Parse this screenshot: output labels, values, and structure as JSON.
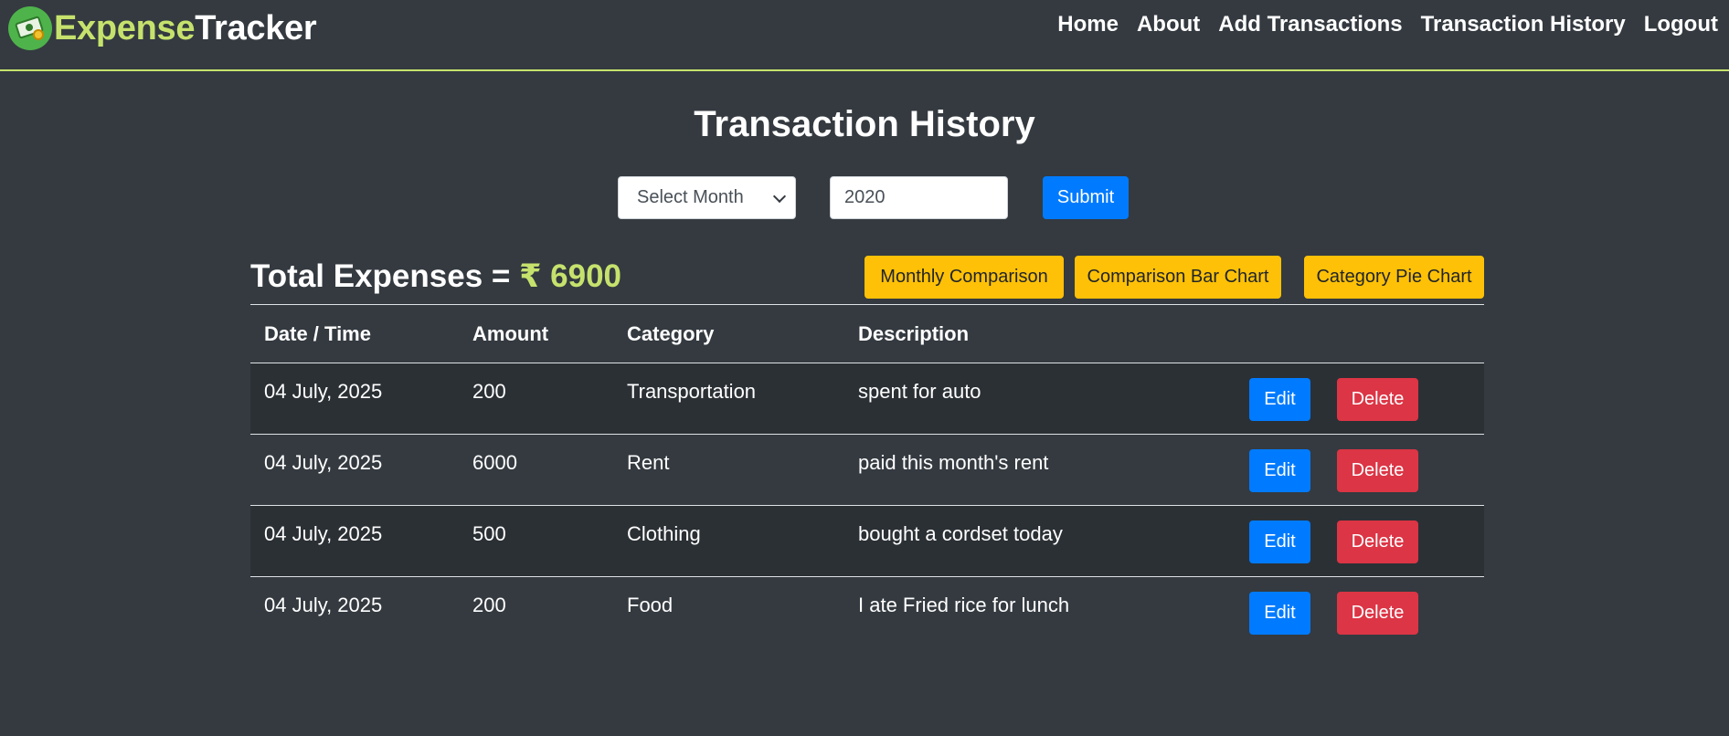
{
  "brand": {
    "part1": "Expense",
    "part2": "Tracker",
    "logo_icon": "money-logo-icon"
  },
  "nav": {
    "links": [
      "Home",
      "About",
      "Add Transactions",
      "Transaction History",
      "Logout"
    ]
  },
  "page": {
    "title": "Transaction History"
  },
  "filter": {
    "month_placeholder": "Select Month",
    "year_value": "2020",
    "submit_label": "Submit"
  },
  "summary": {
    "total_label": "Total Expenses = ",
    "total_amount": "₹ 6900"
  },
  "chart_buttons": {
    "monthly": "Monthly Comparison",
    "bar": "Comparison Bar Chart",
    "pie": "Category Pie Chart"
  },
  "table": {
    "headers": [
      "Date / Time",
      "Amount",
      "Category",
      "Description"
    ],
    "edit_label": "Edit",
    "delete_label": "Delete",
    "rows": [
      {
        "date": "04 July, 2025",
        "amount": "200",
        "category": "Transportation",
        "description": "spent for auto"
      },
      {
        "date": "04 July, 2025",
        "amount": "6000",
        "category": "Rent",
        "description": "paid this month's rent"
      },
      {
        "date": "04 July, 2025",
        "amount": "500",
        "category": "Clothing",
        "description": "bought a cordset today"
      },
      {
        "date": "04 July, 2025",
        "amount": "200",
        "category": "Food",
        "description": "I ate Fried rice for lunch"
      }
    ]
  },
  "colors": {
    "background": "#343a40",
    "accent_green": "#c6e26d",
    "primary_blue": "#007bff",
    "warning_yellow": "#ffc107",
    "danger_red": "#dc3545"
  }
}
